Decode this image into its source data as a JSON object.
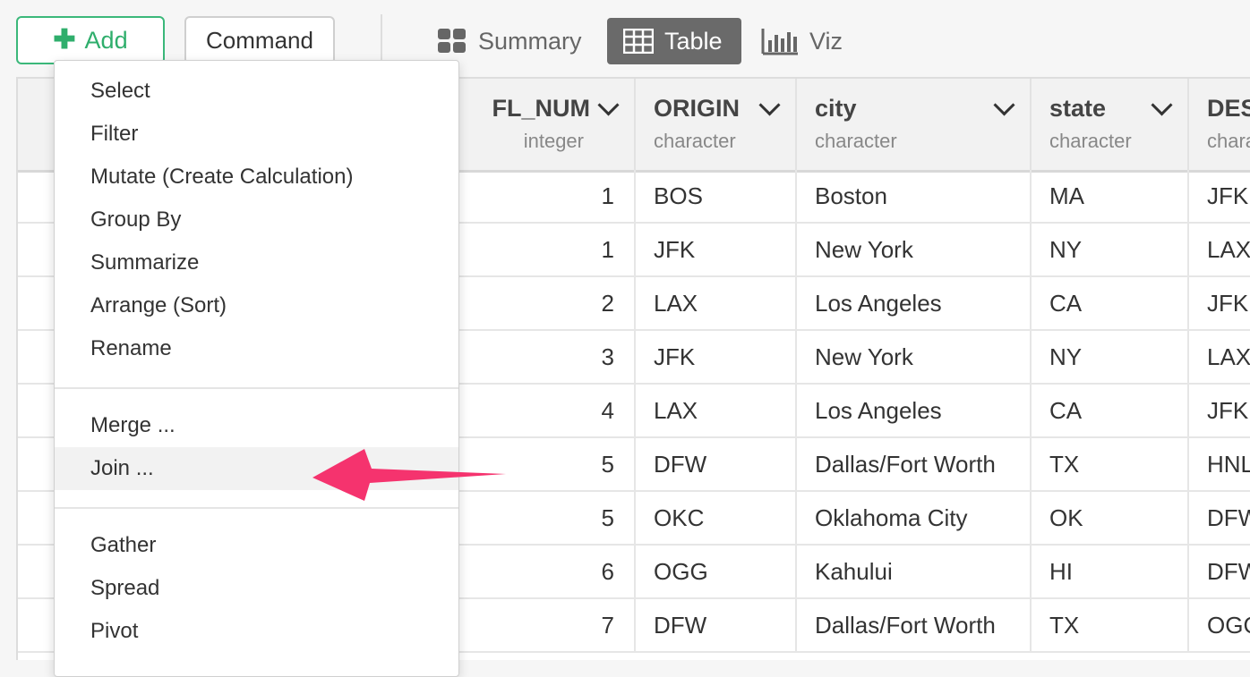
{
  "toolbar": {
    "add_label": "Add",
    "command_label": "Command",
    "tabs": [
      {
        "label": "Summary",
        "icon": "grid-icon"
      },
      {
        "label": "Table",
        "icon": "table-icon",
        "active": true
      },
      {
        "label": "Viz",
        "icon": "bar-chart-icon"
      }
    ]
  },
  "colors": {
    "accent_green": "#2fae6c",
    "active_tab": "#6a6a6a",
    "arrow": "#f5336e"
  },
  "table": {
    "columns": [
      {
        "name": "FL_NUM",
        "type": "integer"
      },
      {
        "name": "ORIGIN",
        "type": "character"
      },
      {
        "name": "city",
        "type": "character"
      },
      {
        "name": "state",
        "type": "character"
      },
      {
        "name": "DES",
        "type": "chara"
      }
    ],
    "rows": [
      [
        "1",
        "BOS",
        "Boston",
        "MA",
        "JFK"
      ],
      [
        "1",
        "JFK",
        "New York",
        "NY",
        "LAX"
      ],
      [
        "2",
        "LAX",
        "Los Angeles",
        "CA",
        "JFK"
      ],
      [
        "3",
        "JFK",
        "New York",
        "NY",
        "LAX"
      ],
      [
        "4",
        "LAX",
        "Los Angeles",
        "CA",
        "JFK"
      ],
      [
        "5",
        "DFW",
        "Dallas/Fort Worth",
        "TX",
        "HNL"
      ],
      [
        "5",
        "OKC",
        "Oklahoma City",
        "OK",
        "DFW"
      ],
      [
        "6",
        "OGG",
        "Kahului",
        "HI",
        "DFW"
      ],
      [
        "7",
        "DFW",
        "Dallas/Fort Worth",
        "TX",
        "OGG"
      ]
    ]
  },
  "menu": {
    "group1": [
      "Select",
      "Filter",
      "Mutate (Create Calculation)",
      "Group By",
      "Summarize",
      "Arrange (Sort)",
      "Rename"
    ],
    "group2": [
      "Merge ...",
      "Join ..."
    ],
    "group3": [
      "Gather",
      "Spread",
      "Pivot"
    ]
  }
}
